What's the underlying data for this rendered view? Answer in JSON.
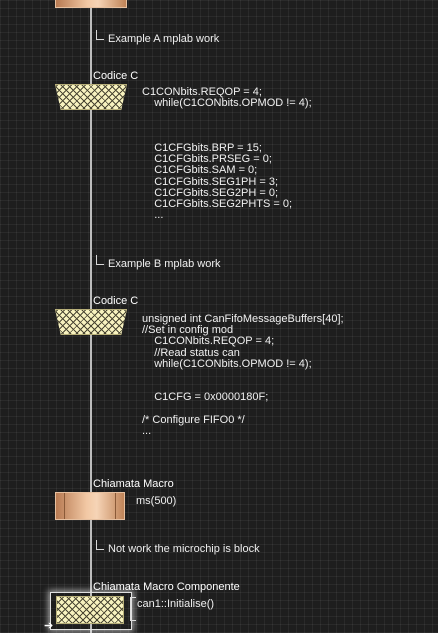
{
  "comments": [
    {
      "text": "Example A mplab work"
    },
    {
      "text": "Example B mplab work"
    },
    {
      "text": "Not work the microchip is block"
    }
  ],
  "blocks": {
    "code_c_1": {
      "title": "Codice C",
      "code": "C1CONbits.REQOP = 4;\n    while(C1CONbits.OPMOD != 4);\n\n\n\n    C1CFGbits.BRP = 15;\n    C1CFGbits.PRSEG = 0;\n    C1CFGbits.SAM = 0;\n    C1CFGbits.SEG1PH = 3;\n    C1CFGbits.SEG2PH = 0;\n    C1CFGbits.SEG2PHTS = 0;\n    ..."
    },
    "code_c_2": {
      "title": "Codice C",
      "code": "unsigned int CanFifoMessageBuffers[40];\n//Set in config mod\n    C1CONbits.REQOP = 4;\n    //Read status can\n    while(C1CONbits.OPMOD != 4);\n\n\n    C1CFG = 0x0000180F;\n\n/* Configure FIFO0 */\n..."
    },
    "macro": {
      "title": "Chiamata Macro",
      "call": "ms(500)"
    },
    "component_macro": {
      "title": "Chiamata Macro Componente",
      "call": "can1::Initialise()"
    }
  },
  "icons": {
    "cursor": "arrow-cursor-icon",
    "code_block": "code-block-icon",
    "macro_block": "macro-block-icon"
  },
  "colors": {
    "background": "#1e1e1e",
    "spine": "#bdbdbd",
    "code_block_fill": "#f7f2bf",
    "macro_block_fill": "#f2c8a4"
  }
}
